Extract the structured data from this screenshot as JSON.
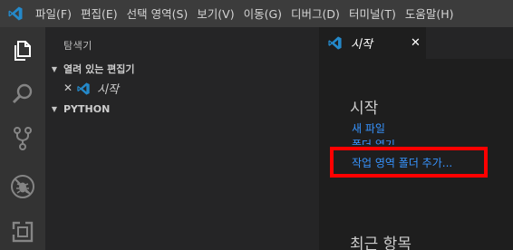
{
  "menubar": {
    "items": [
      "파일(F)",
      "편집(E)",
      "선택 영역(S)",
      "보기(V)",
      "이동(G)",
      "디버그(D)",
      "터미널(T)",
      "도움말(H)"
    ]
  },
  "sidebar": {
    "title": "탐색기",
    "open_editors_header": "열려 있는 편집기",
    "open_editor_item": "시작",
    "python_header": "PYTHON"
  },
  "tab": {
    "label": "시작"
  },
  "welcome": {
    "start_heading": "시작",
    "new_file": "새 파일",
    "open_folder": "폴더 열기",
    "add_workspace_folder": "작업 영역 폴더 추가...",
    "recent_heading": "최근 항목"
  },
  "colors": {
    "accent_blue": "#3794ff",
    "highlight_red": "#ff0000",
    "vscode_blue": "#2489ca"
  }
}
